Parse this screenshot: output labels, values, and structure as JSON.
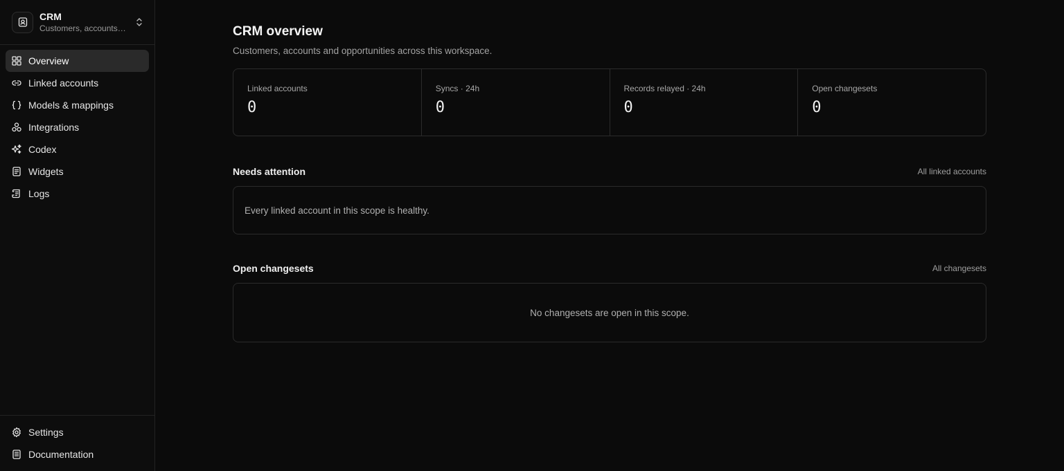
{
  "workspace": {
    "name": "CRM",
    "subtitle": "Customers, accounts and opportunities across this workspace."
  },
  "nav": {
    "items": [
      {
        "label": "Overview",
        "icon": "grid-icon"
      },
      {
        "label": "Linked accounts",
        "icon": "link-icon"
      },
      {
        "label": "Models & mappings",
        "icon": "braces-icon"
      },
      {
        "label": "Integrations",
        "icon": "integrations-icon"
      },
      {
        "label": "Codex",
        "icon": "sparkles-icon"
      },
      {
        "label": "Widgets",
        "icon": "widget-icon"
      },
      {
        "label": "Logs",
        "icon": "logs-icon"
      }
    ],
    "active": "Overview",
    "bottom": [
      {
        "label": "Settings",
        "icon": "gear-icon"
      },
      {
        "label": "Documentation",
        "icon": "book-icon"
      }
    ]
  },
  "page": {
    "title": "CRM overview",
    "subtitle": "Customers, accounts and opportunities across this workspace."
  },
  "stats": [
    {
      "label": "Linked accounts",
      "value": "0"
    },
    {
      "label": "Syncs · 24h",
      "value": "0"
    },
    {
      "label": "Records relayed · 24h",
      "value": "0"
    },
    {
      "label": "Open changesets",
      "value": "0"
    }
  ],
  "attention": {
    "title": "Needs attention",
    "link": "All linked accounts",
    "empty": "Every linked account in this scope is healthy."
  },
  "changesets": {
    "title": "Open changesets",
    "link": "All changesets",
    "empty": "No changesets are open in this scope."
  }
}
